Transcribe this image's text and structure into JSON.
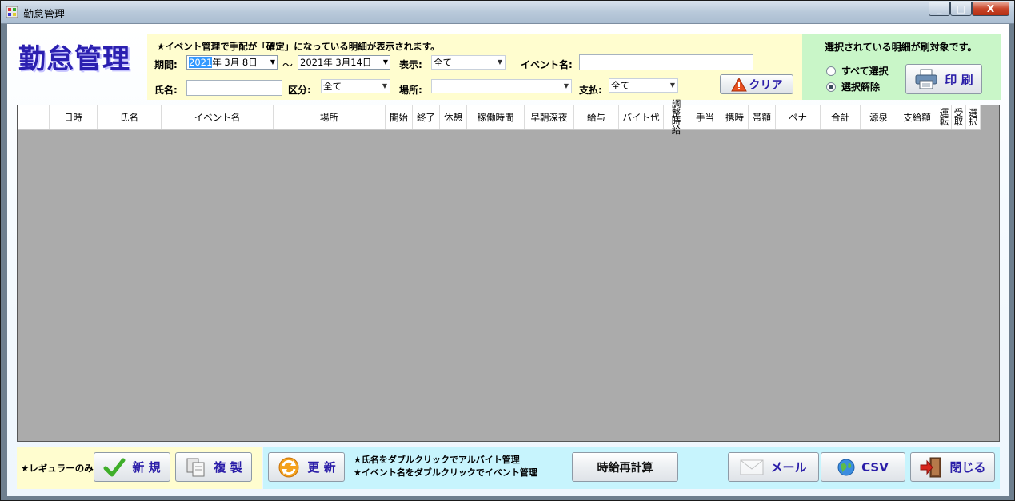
{
  "window": {
    "title": "勤怠管理",
    "minimize": "_",
    "maximize": "□",
    "close": "X"
  },
  "logo": "勤怠管理",
  "filter": {
    "notice": "★イベント管理で手配が「確定」になっている明細が表示されます。",
    "period_label": "期間:",
    "date_from_year": "2021",
    "date_from_rest": "年  3月  8日",
    "tilde": "～",
    "date_to": "2021年  3月14日",
    "display_label": "表示:",
    "display_value": "全て",
    "event_label": "イベント名:",
    "event_value": "",
    "name_label": "氏名:",
    "name_value": "",
    "category_label": "区分:",
    "category_value": "全て",
    "place_label": "場所:",
    "place_value": "",
    "payment_label": "支払:",
    "payment_value": "全て",
    "clear_button": "クリア"
  },
  "print": {
    "notice": "選択されている明細が刷対象です。",
    "select_all": "すべて選択",
    "deselect": "選択解除",
    "print_button": "印 刷"
  },
  "grid": {
    "columns": [
      "",
      "日時",
      "氏名",
      "イベント名",
      "場所",
      "開始",
      "終了",
      "休憩",
      "稼働時間",
      "早朝深夜",
      "給与",
      "バイト代",
      "調整時給",
      "手当",
      "携時",
      "帯額",
      "ペナ",
      "合計",
      "源泉",
      "支給額",
      "運転",
      "受取",
      "選択"
    ]
  },
  "bottom": {
    "regular_only": "★レギュラーのみ",
    "new_button": "新 規",
    "copy_button": "複 製",
    "refresh_button": "更 新",
    "hint1": "★氏名をダブルクリックでアルバイト管理",
    "hint2": "★イベント名をダブルクリックでイベント管理",
    "recalc_button": "時給再計算",
    "mail_button": "メール",
    "csv_button": "CSV",
    "close_button": "閉じる"
  },
  "colors": {
    "accent": "#2a1da8",
    "filter_bg": "#fffdcf",
    "print_bg": "#c9f6c8",
    "bottom_bg": "#c7f4fd",
    "grid_bg": "#ababab"
  }
}
